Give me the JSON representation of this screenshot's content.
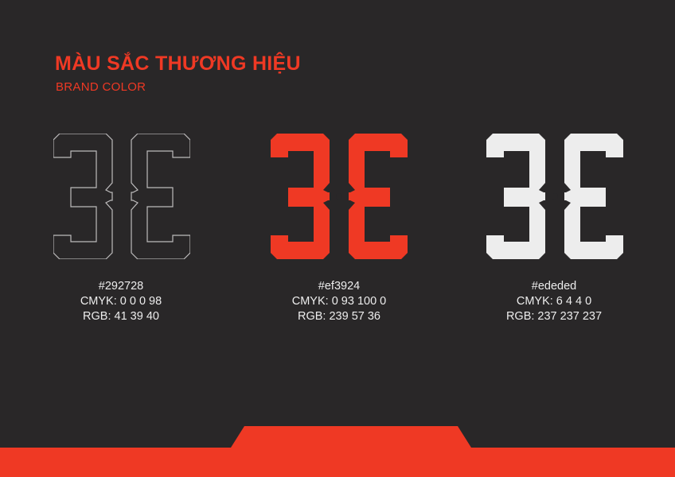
{
  "heading": {
    "title": "MÀU SẮC THƯƠNG HIỆU",
    "subtitle": "BRAND COLOR"
  },
  "swatches": [
    {
      "hex": "#292728",
      "cmyk": "CMYK: 0 0 0 98",
      "rgb": "RGB: 41 39 40",
      "fill": "#292728",
      "stroke": "#bdbbbc",
      "style": "outline"
    },
    {
      "hex": "#ef3924",
      "cmyk": "CMYK: 0 93 100 0",
      "rgb": "RGB: 239 57 36",
      "fill": "#ef3924",
      "stroke": "#ef3924",
      "style": "solid"
    },
    {
      "hex": "#ededed",
      "cmyk": "CMYK: 6 4 4 0",
      "rgb": "RGB: 237 237 237",
      "fill": "#ededed",
      "stroke": "#ededed",
      "style": "solid"
    }
  ],
  "colors": {
    "background": "#292728",
    "accent": "#ef3924",
    "light": "#ededed"
  }
}
